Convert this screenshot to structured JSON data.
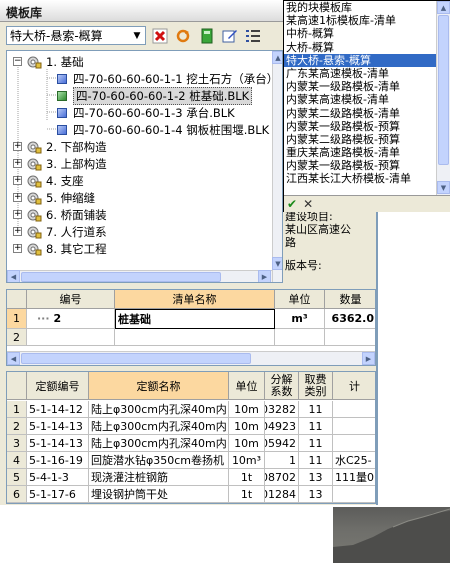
{
  "window": {
    "title": "模板库"
  },
  "template_select": {
    "value": "特大桥-悬索-概算"
  },
  "toolbar": {
    "buttons": [
      {
        "name": "delete-button",
        "icon": "delete-x-icon"
      },
      {
        "name": "refresh-button",
        "icon": "refresh-icon"
      },
      {
        "name": "book-button",
        "icon": "book-icon"
      },
      {
        "name": "edit-button",
        "icon": "edit-icon"
      },
      {
        "name": "list-button",
        "icon": "list-icon"
      }
    ]
  },
  "tree": {
    "root": "1. 基础",
    "children": [
      {
        "label": "四-70-60-60-60-1-1  挖土石方（承台）",
        "selected": false
      },
      {
        "label": "四-70-60-60-60-1-2  桩基础.BLK",
        "selected": true
      },
      {
        "label": "四-70-60-60-60-1-3  承台.BLK",
        "selected": false
      },
      {
        "label": "四-70-60-60-60-1-4  钢板桩围堰.BLK",
        "selected": false
      }
    ],
    "groups": [
      "2. 下部构造",
      "3. 上部构造",
      "4. 支座",
      "5. 伸缩缝",
      "6. 桥面铺装",
      "7. 人行道系",
      "8. 其它工程"
    ]
  },
  "template_list": {
    "items": [
      "我的块模板库",
      "某高速1标模板库-清单",
      "中桥-概算",
      "大桥-概算",
      "特大桥-悬索-概算",
      "广东某高速模板-清单",
      "内蒙某一级路模板-清单",
      "内蒙某高速模板-清单",
      "内蒙某二级路模板-清单",
      "内蒙某一级路模板-预算",
      "内蒙某二级路模板-预算",
      "重庆某高速路模板-清单",
      "内蒙某一级路模板-预算",
      "江西某长江大桥模板-清单"
    ],
    "selected_index": 4,
    "confirm_icon": "✔",
    "cancel_icon": "✕"
  },
  "info": {
    "line1": "建设项目:",
    "line2": "某山区高速公",
    "line3": "路",
    "line4": "版本号:"
  },
  "bill_table": {
    "headers": [
      "编号",
      "清单名称",
      "单位",
      "数量"
    ],
    "rows": [
      {
        "num": "1",
        "code": "2",
        "name": "桩基础",
        "unit": "m³",
        "qty": "6362.0"
      },
      {
        "num": "2",
        "code": "",
        "name": "",
        "unit": "",
        "qty": ""
      }
    ]
  },
  "quota_table": {
    "headers": [
      "定额编号",
      "定额名称",
      "单位",
      "分解系数",
      "取费类别",
      "计"
    ],
    "rows": [
      {
        "num": "1",
        "code": "5-1-14-12",
        "name": "陆上φ300cm内孔深40m内",
        "unit": "10m",
        "coef": "03282",
        "cat": "11",
        "extra": ""
      },
      {
        "num": "2",
        "code": "5-1-14-13",
        "name": "陆上φ300cm内孔深40m内",
        "unit": "10m",
        "coef": "04923",
        "cat": "11",
        "extra": ""
      },
      {
        "num": "3",
        "code": "5-1-14-13",
        "name": "陆上φ300cm内孔深40m内",
        "unit": "10m",
        "coef": "05942",
        "cat": "11",
        "extra": ""
      },
      {
        "num": "4",
        "code": "5-1-16-19",
        "name": "回旋潜水钻φ350cm卷扬机",
        "unit": "10m³",
        "coef": "1",
        "cat": "11",
        "extra": "水C25-"
      },
      {
        "num": "5",
        "code": "5-4-1-3",
        "name": "现浇灌注桩钢筋",
        "unit": "1t",
        "coef": "08702",
        "cat": "13",
        "extra": "111量0"
      },
      {
        "num": "6",
        "code": "5-1-17-6",
        "name": "埋设钢护筒干处",
        "unit": "1t",
        "coef": "01284",
        "cat": "13",
        "extra": ""
      }
    ]
  }
}
